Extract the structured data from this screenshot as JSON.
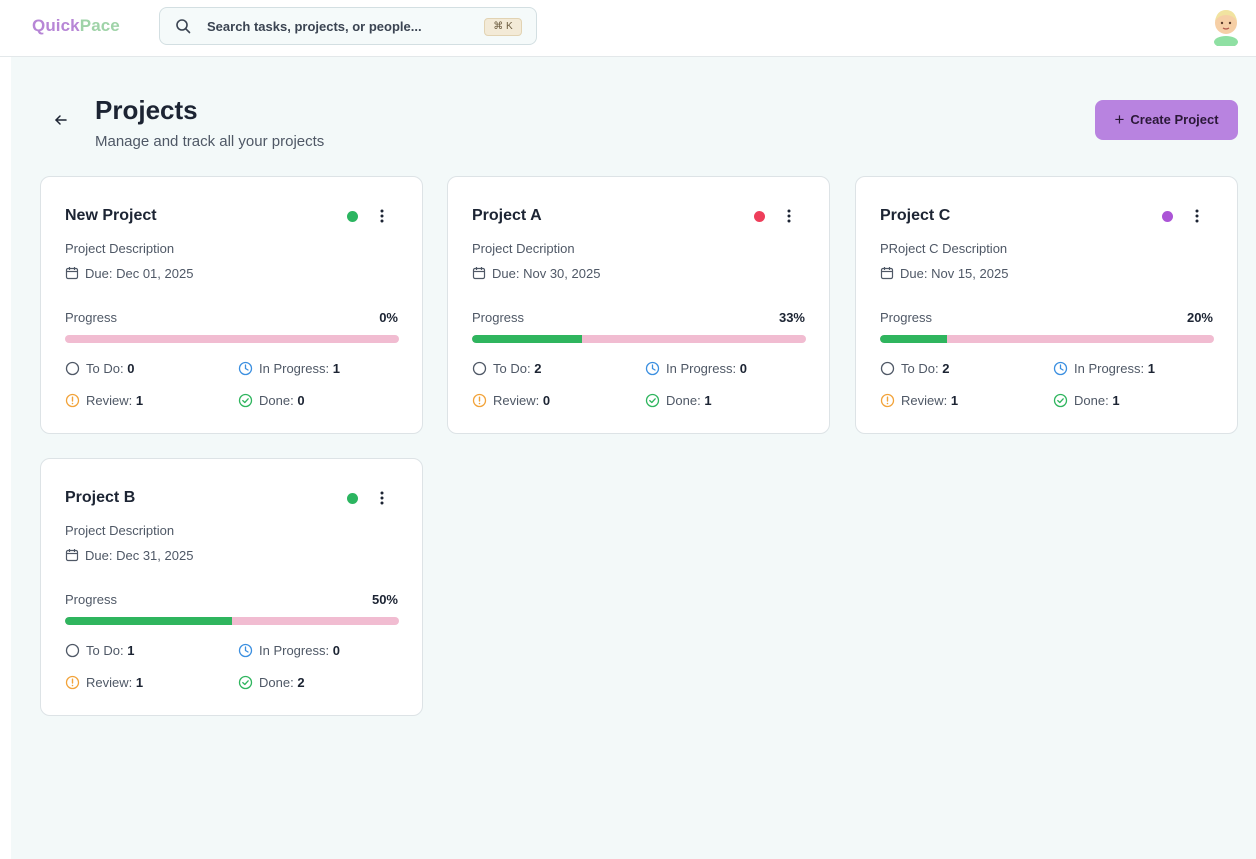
{
  "app": {
    "logo_part1": "Quick",
    "logo_part2": "Pace"
  },
  "search": {
    "placeholder": "Search tasks, projects, or people...",
    "shortcut": "⌘ K"
  },
  "page": {
    "title": "Projects",
    "subtitle": "Manage and track all your projects",
    "create_label": "Create Project"
  },
  "labels": {
    "due_prefix": "Due:",
    "progress": "Progress",
    "todo": "To Do:",
    "in_progress": "In Progress:",
    "review": "Review:",
    "done": "Done:"
  },
  "colors": {
    "accent": "#b883e0",
    "progress_fill": "#2fb55e",
    "progress_track": "#f1bcd1",
    "status_green": "#2bb560",
    "status_red": "#ee3e5a",
    "status_purple": "#ab54d6",
    "icon_todo": "#4f5866",
    "icon_in_progress": "#3b8fe0",
    "icon_review": "#f2a33a",
    "icon_done": "#2fb55e"
  },
  "projects": [
    {
      "name": "New Project",
      "description": "Project Description",
      "due": "Dec 01, 2025",
      "status_color": "#2bb560",
      "progress_label": "0%",
      "progress": 0,
      "todo": "0",
      "in_progress": "1",
      "review": "1",
      "done": "0"
    },
    {
      "name": "Project A",
      "description": "Project Decription",
      "due": "Nov 30, 2025",
      "status_color": "#ee3e5a",
      "progress_label": "33%",
      "progress": 33,
      "todo": "2",
      "in_progress": "0",
      "review": "0",
      "done": "1"
    },
    {
      "name": "Project C",
      "description": "PRoject C Description",
      "due": "Nov 15, 2025",
      "status_color": "#ab54d6",
      "progress_label": "20%",
      "progress": 20,
      "todo": "2",
      "in_progress": "1",
      "review": "1",
      "done": "1"
    },
    {
      "name": "Project B",
      "description": "Project Description",
      "due": "Dec 31, 2025",
      "status_color": "#2bb560",
      "progress_label": "50%",
      "progress": 50,
      "todo": "1",
      "in_progress": "0",
      "review": "1",
      "done": "2"
    }
  ]
}
